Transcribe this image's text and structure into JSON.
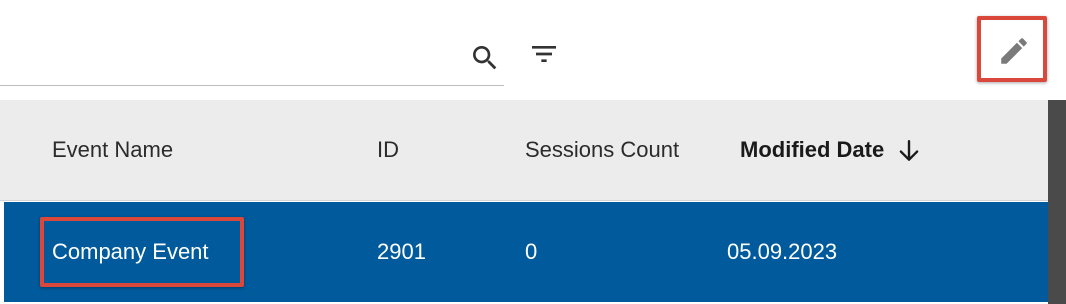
{
  "toolbar": {
    "search": {
      "value": "",
      "placeholder": "",
      "icon": "search-icon"
    },
    "filter_icon": "filter-icon",
    "edit_icon": "pencil-icon"
  },
  "table": {
    "columns": [
      {
        "key": "name",
        "label": "Event Name"
      },
      {
        "key": "id",
        "label": "ID"
      },
      {
        "key": "sessions",
        "label": "Sessions Count"
      },
      {
        "key": "modified",
        "label": "Modified Date",
        "sorted": "descending"
      }
    ],
    "rows": [
      {
        "name": "Company Event",
        "id": "2901",
        "sessions": "0",
        "modified": "05.09.2023",
        "selected": true
      }
    ]
  },
  "colors": {
    "selected_row": "#005a9c",
    "header_bg": "#ececec",
    "highlight_border": "#d9483a"
  }
}
